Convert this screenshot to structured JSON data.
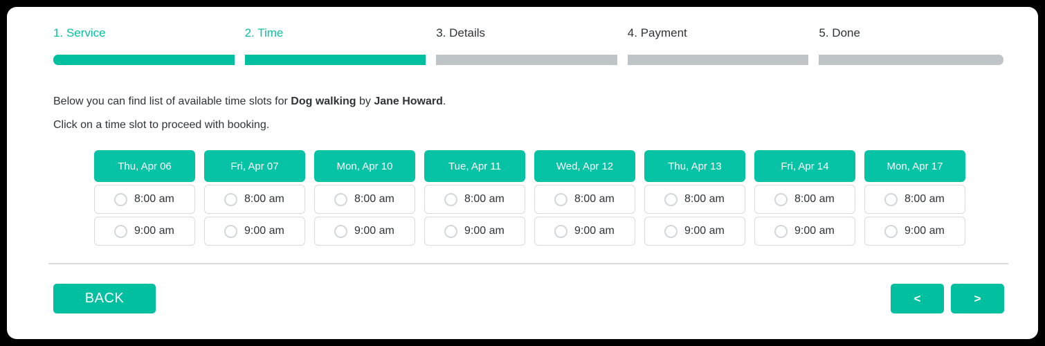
{
  "theme": {
    "accent": "#02bfa0",
    "accent_header": "#05c3a4",
    "inactive_bar": "#bfc4c8",
    "text": "#2e3436",
    "slot_border": "#d8dcde"
  },
  "steps": [
    {
      "label": "1. Service",
      "state": "active"
    },
    {
      "label": "2. Time",
      "state": "active"
    },
    {
      "label": "3. Details",
      "state": "inactive"
    },
    {
      "label": "4. Payment",
      "state": "inactive"
    },
    {
      "label": "5. Done",
      "state": "inactive"
    }
  ],
  "intro": {
    "line1_prefix": "Below you can find list of available time slots for ",
    "service": "Dog walking",
    "line1_mid": " by ",
    "provider": "Jane Howard",
    "line1_suffix": ".",
    "line2": "Click on a time slot to proceed with booking."
  },
  "schedule": {
    "days": [
      {
        "label": "Thu, Apr 06",
        "slots": [
          "8:00 am",
          "9:00 am"
        ]
      },
      {
        "label": "Fri, Apr 07",
        "slots": [
          "8:00 am",
          "9:00 am"
        ]
      },
      {
        "label": "Mon, Apr 10",
        "slots": [
          "8:00 am",
          "9:00 am"
        ]
      },
      {
        "label": "Tue, Apr 11",
        "slots": [
          "8:00 am",
          "9:00 am"
        ]
      },
      {
        "label": "Wed, Apr 12",
        "slots": [
          "8:00 am",
          "9:00 am"
        ]
      },
      {
        "label": "Thu, Apr 13",
        "slots": [
          "8:00 am",
          "9:00 am"
        ]
      },
      {
        "label": "Fri, Apr 14",
        "slots": [
          "8:00 am",
          "9:00 am"
        ]
      },
      {
        "label": "Mon, Apr 17",
        "slots": [
          "8:00 am",
          "9:00 am"
        ]
      }
    ]
  },
  "footer": {
    "back_label": "BACK",
    "prev_label": "<",
    "next_label": ">"
  }
}
